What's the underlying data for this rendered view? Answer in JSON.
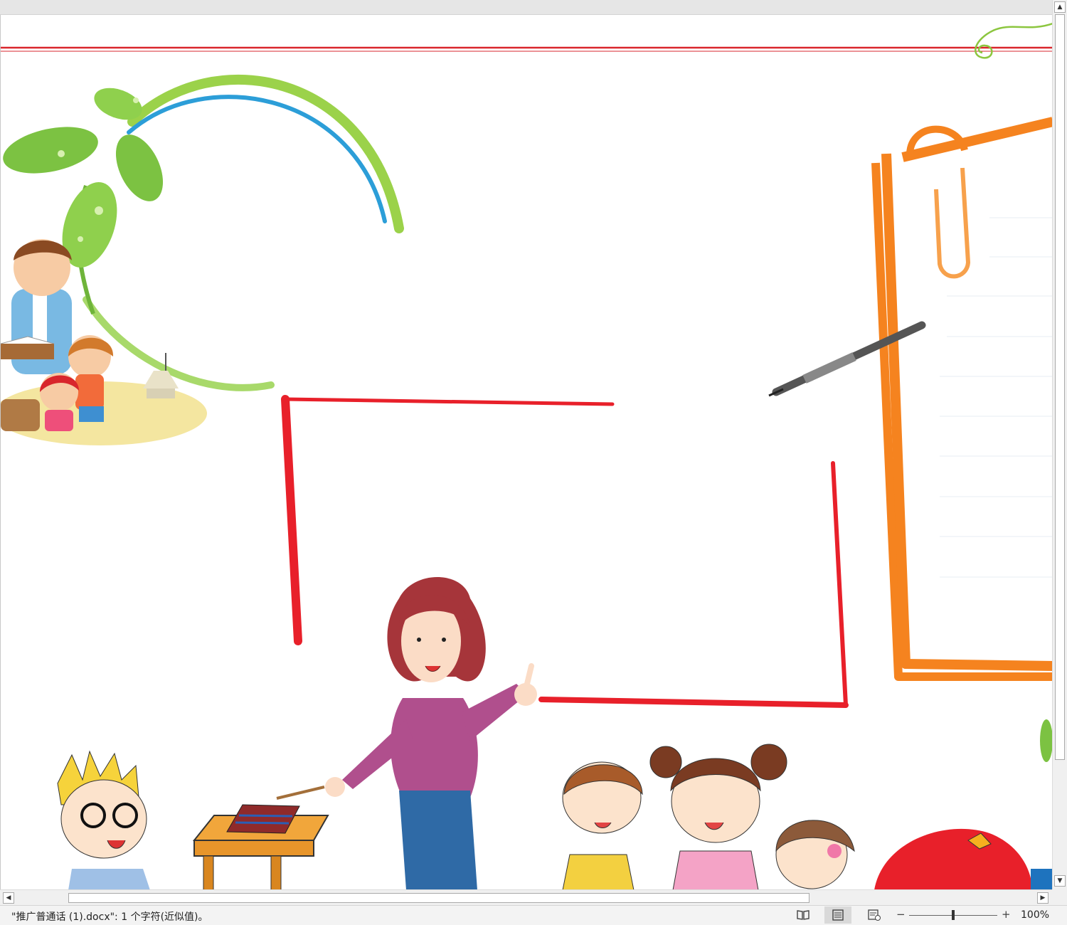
{
  "document": {
    "filename": "推广普通话 (1).docx",
    "artwork": {
      "colors": {
        "header_rule": "#d9262c",
        "red_frame": "#e8202a",
        "orange_frame": "#f5831f",
        "leaf_green": "#7cc242",
        "swirl_green": "#8cc63f"
      },
      "elements": [
        "leaf-vine",
        "family-illustration",
        "red-frame",
        "orange-notebook",
        "pencil",
        "teacher",
        "children"
      ]
    }
  },
  "status_bar": {
    "text": "\"推广普通话 (1).docx\": 1 个字符(近似值)。",
    "views": [
      "read-mode-icon",
      "print-layout-icon",
      "web-layout-icon"
    ],
    "zoom": {
      "minus": "−",
      "plus": "+",
      "level": "100%",
      "value_percent": 100
    }
  },
  "scrollbars": {
    "up": "▲",
    "down": "▼",
    "left": "◀",
    "right": "▶"
  }
}
